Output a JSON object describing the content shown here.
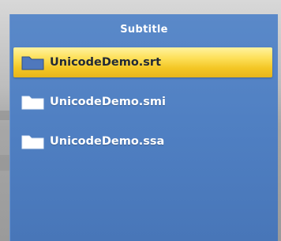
{
  "menu": {
    "title": "Subtitle",
    "items": [
      {
        "label": "UnicodeDemo.srt",
        "icon": "folder-icon",
        "selected": true
      },
      {
        "label": "UnicodeDemo.smi",
        "icon": "folder-icon",
        "selected": false
      },
      {
        "label": "UnicodeDemo.ssa",
        "icon": "folder-icon",
        "selected": false
      }
    ]
  },
  "colors": {
    "panel": "#5180c3",
    "highlight": "#f6cc2e",
    "text_white": "#ffffff",
    "text_dark": "#222a36"
  }
}
